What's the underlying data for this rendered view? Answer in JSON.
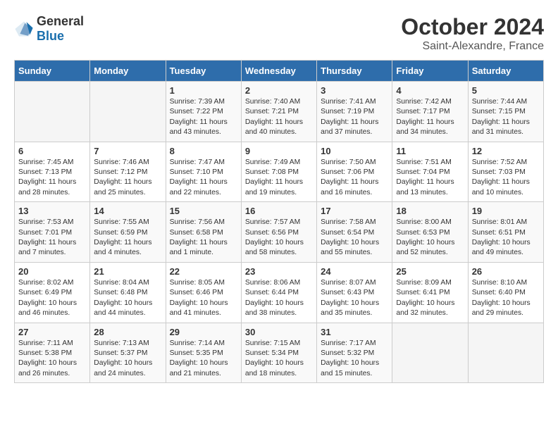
{
  "header": {
    "logo_general": "General",
    "logo_blue": "Blue",
    "month": "October 2024",
    "location": "Saint-Alexandre, France"
  },
  "columns": [
    "Sunday",
    "Monday",
    "Tuesday",
    "Wednesday",
    "Thursday",
    "Friday",
    "Saturday"
  ],
  "weeks": [
    [
      {
        "day": "",
        "info": ""
      },
      {
        "day": "",
        "info": ""
      },
      {
        "day": "1",
        "info": "Sunrise: 7:39 AM\nSunset: 7:22 PM\nDaylight: 11 hours and 43 minutes."
      },
      {
        "day": "2",
        "info": "Sunrise: 7:40 AM\nSunset: 7:21 PM\nDaylight: 11 hours and 40 minutes."
      },
      {
        "day": "3",
        "info": "Sunrise: 7:41 AM\nSunset: 7:19 PM\nDaylight: 11 hours and 37 minutes."
      },
      {
        "day": "4",
        "info": "Sunrise: 7:42 AM\nSunset: 7:17 PM\nDaylight: 11 hours and 34 minutes."
      },
      {
        "day": "5",
        "info": "Sunrise: 7:44 AM\nSunset: 7:15 PM\nDaylight: 11 hours and 31 minutes."
      }
    ],
    [
      {
        "day": "6",
        "info": "Sunrise: 7:45 AM\nSunset: 7:13 PM\nDaylight: 11 hours and 28 minutes."
      },
      {
        "day": "7",
        "info": "Sunrise: 7:46 AM\nSunset: 7:12 PM\nDaylight: 11 hours and 25 minutes."
      },
      {
        "day": "8",
        "info": "Sunrise: 7:47 AM\nSunset: 7:10 PM\nDaylight: 11 hours and 22 minutes."
      },
      {
        "day": "9",
        "info": "Sunrise: 7:49 AM\nSunset: 7:08 PM\nDaylight: 11 hours and 19 minutes."
      },
      {
        "day": "10",
        "info": "Sunrise: 7:50 AM\nSunset: 7:06 PM\nDaylight: 11 hours and 16 minutes."
      },
      {
        "day": "11",
        "info": "Sunrise: 7:51 AM\nSunset: 7:04 PM\nDaylight: 11 hours and 13 minutes."
      },
      {
        "day": "12",
        "info": "Sunrise: 7:52 AM\nSunset: 7:03 PM\nDaylight: 11 hours and 10 minutes."
      }
    ],
    [
      {
        "day": "13",
        "info": "Sunrise: 7:53 AM\nSunset: 7:01 PM\nDaylight: 11 hours and 7 minutes."
      },
      {
        "day": "14",
        "info": "Sunrise: 7:55 AM\nSunset: 6:59 PM\nDaylight: 11 hours and 4 minutes."
      },
      {
        "day": "15",
        "info": "Sunrise: 7:56 AM\nSunset: 6:58 PM\nDaylight: 11 hours and 1 minute."
      },
      {
        "day": "16",
        "info": "Sunrise: 7:57 AM\nSunset: 6:56 PM\nDaylight: 10 hours and 58 minutes."
      },
      {
        "day": "17",
        "info": "Sunrise: 7:58 AM\nSunset: 6:54 PM\nDaylight: 10 hours and 55 minutes."
      },
      {
        "day": "18",
        "info": "Sunrise: 8:00 AM\nSunset: 6:53 PM\nDaylight: 10 hours and 52 minutes."
      },
      {
        "day": "19",
        "info": "Sunrise: 8:01 AM\nSunset: 6:51 PM\nDaylight: 10 hours and 49 minutes."
      }
    ],
    [
      {
        "day": "20",
        "info": "Sunrise: 8:02 AM\nSunset: 6:49 PM\nDaylight: 10 hours and 46 minutes."
      },
      {
        "day": "21",
        "info": "Sunrise: 8:04 AM\nSunset: 6:48 PM\nDaylight: 10 hours and 44 minutes."
      },
      {
        "day": "22",
        "info": "Sunrise: 8:05 AM\nSunset: 6:46 PM\nDaylight: 10 hours and 41 minutes."
      },
      {
        "day": "23",
        "info": "Sunrise: 8:06 AM\nSunset: 6:44 PM\nDaylight: 10 hours and 38 minutes."
      },
      {
        "day": "24",
        "info": "Sunrise: 8:07 AM\nSunset: 6:43 PM\nDaylight: 10 hours and 35 minutes."
      },
      {
        "day": "25",
        "info": "Sunrise: 8:09 AM\nSunset: 6:41 PM\nDaylight: 10 hours and 32 minutes."
      },
      {
        "day": "26",
        "info": "Sunrise: 8:10 AM\nSunset: 6:40 PM\nDaylight: 10 hours and 29 minutes."
      }
    ],
    [
      {
        "day": "27",
        "info": "Sunrise: 7:11 AM\nSunset: 5:38 PM\nDaylight: 10 hours and 26 minutes."
      },
      {
        "day": "28",
        "info": "Sunrise: 7:13 AM\nSunset: 5:37 PM\nDaylight: 10 hours and 24 minutes."
      },
      {
        "day": "29",
        "info": "Sunrise: 7:14 AM\nSunset: 5:35 PM\nDaylight: 10 hours and 21 minutes."
      },
      {
        "day": "30",
        "info": "Sunrise: 7:15 AM\nSunset: 5:34 PM\nDaylight: 10 hours and 18 minutes."
      },
      {
        "day": "31",
        "info": "Sunrise: 7:17 AM\nSunset: 5:32 PM\nDaylight: 10 hours and 15 minutes."
      },
      {
        "day": "",
        "info": ""
      },
      {
        "day": "",
        "info": ""
      }
    ]
  ]
}
